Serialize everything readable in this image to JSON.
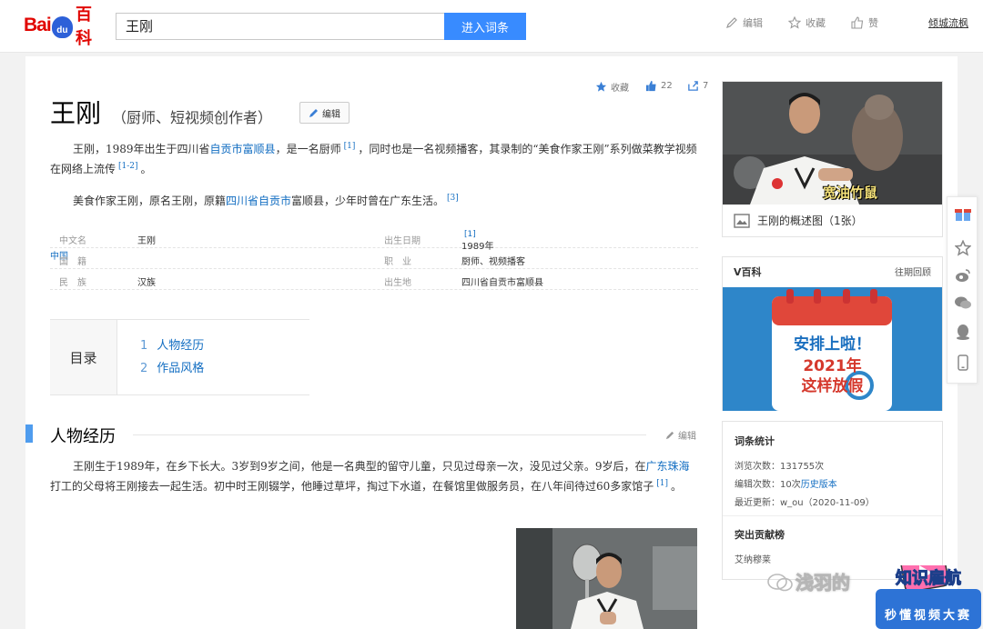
{
  "header": {
    "logo_bai": "Bai",
    "logo_du": "du",
    "logo_baike": "百科",
    "search_value": "王刚",
    "enter_button": "进入词条",
    "edit": "编辑",
    "favorite": "收藏",
    "like": "赞",
    "user": "倾城流枫"
  },
  "entry": {
    "title": "王刚",
    "subtitle": "（厨师、短视频创作者）",
    "edit_button": "编辑",
    "fav_label": "收藏",
    "like_count": "22",
    "share_count": "7",
    "intro1_a": "王刚，1989年出生于四川省",
    "intro1_link": "自贡市富顺县",
    "intro1_b": "，是一名厨师",
    "intro1_ref1": "[1]",
    "intro1_c": "，同时也是一名视频播客，其录制的“美食作家王刚”系列做菜教学视频在网络上流传",
    "intro1_ref2": "[1-2]",
    "intro1_d": "。",
    "intro2_a": "美食作家王刚，原名王刚，原籍",
    "intro2_link": "四川省自贡市",
    "intro2_b": "富顺县，少年时曾在广东生活。",
    "intro2_ref": "[3]"
  },
  "infobox": {
    "rows": [
      {
        "k1": "中文名",
        "v1": "王刚",
        "k2": "出生日期",
        "v2": "1989年",
        "ref": "[1]"
      },
      {
        "k1": "国　籍",
        "v1": "中国",
        "k2": "职　业",
        "v2": "厨师、视频播客"
      },
      {
        "k1": "民　族",
        "v1": "汉族",
        "k2": "出生地",
        "v2": "四川省自贡市富顺县"
      }
    ]
  },
  "toc": {
    "heading": "目录",
    "items": [
      {
        "num": "1",
        "label": "人物经历"
      },
      {
        "num": "2",
        "label": "作品风格"
      }
    ]
  },
  "section1": {
    "title": "人物经历",
    "edit": "编辑",
    "p_a": "王刚生于1989年，在乡下长大。3岁到9岁之间，他是一名典型的留守儿童，只见过母亲一次，没见过父亲。9岁后，在",
    "p_link": "广东珠海",
    "p_b": "打工的父母将王刚接去一起生活。初中时王刚辍学，他睡过草坪，掏过下水道，在餐馆里做服务员，在八年间待过60多家馆子",
    "p_ref": "[1]",
    "p_c": "。"
  },
  "sidebar": {
    "photo_caption_overlay": "宽油竹鼠",
    "photo_caption": "王刚的概述图（1张）",
    "v_title": "V百科",
    "v_history": "往期回顾",
    "v_line1": "安排上啦！",
    "v_line2": "2021年",
    "v_line3": "这样放假",
    "stats_title": "词条统计",
    "views": "浏览次数：131755次",
    "edits_prefix": "编辑次数：10次",
    "edits_link": "历史版本",
    "updated": "最近更新：w_ou（2020-11-09）",
    "contrib_title": "突出贡献榜",
    "contrib_name": "艾纳穆莱"
  },
  "watermark": {
    "text": "浅羽的",
    "badge_top": "知识雇航",
    "badge_bottom": "秒懂视频大赛"
  },
  "colors": {
    "accent": "#388bff",
    "link": "#136ec2",
    "brand_red": "#e10602"
  }
}
